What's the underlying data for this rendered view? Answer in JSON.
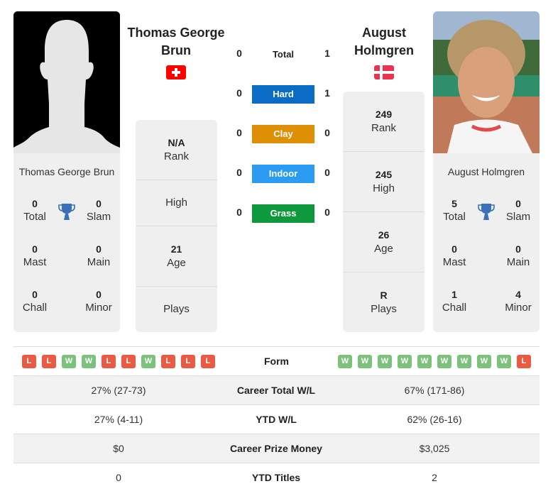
{
  "player_left": {
    "name": "Thomas George Brun",
    "name_line1": "Thomas George",
    "name_line2": "Brun",
    "country_flag": "switzerland-flag",
    "photo": "silhouette-placeholder",
    "titles": {
      "total": {
        "value": "0",
        "label": "Total"
      },
      "slam": {
        "value": "0",
        "label": "Slam"
      },
      "mast": {
        "value": "0",
        "label": "Mast"
      },
      "main": {
        "value": "0",
        "label": "Main"
      },
      "chall": {
        "value": "0",
        "label": "Chall"
      },
      "minor": {
        "value": "0",
        "label": "Minor"
      }
    },
    "ranking": [
      {
        "value": "N/A",
        "label": "Rank"
      },
      {
        "value": "",
        "label": "High"
      },
      {
        "value": "21",
        "label": "Age"
      },
      {
        "value": "",
        "label": "Plays"
      }
    ],
    "form": [
      "L",
      "L",
      "W",
      "W",
      "L",
      "L",
      "W",
      "L",
      "L",
      "L"
    ]
  },
  "player_right": {
    "name": "August Holmgren",
    "name_line1": "August",
    "name_line2": "Holmgren",
    "country_flag": "denmark-flag",
    "photo": "player-photo",
    "titles": {
      "total": {
        "value": "5",
        "label": "Total"
      },
      "slam": {
        "value": "0",
        "label": "Slam"
      },
      "mast": {
        "value": "0",
        "label": "Mast"
      },
      "main": {
        "value": "0",
        "label": "Main"
      },
      "chall": {
        "value": "1",
        "label": "Chall"
      },
      "minor": {
        "value": "4",
        "label": "Minor"
      }
    },
    "ranking": [
      {
        "value": "249",
        "label": "Rank"
      },
      {
        "value": "245",
        "label": "High"
      },
      {
        "value": "26",
        "label": "Age"
      },
      {
        "value": "R",
        "label": "Plays"
      }
    ],
    "form": [
      "W",
      "W",
      "W",
      "W",
      "W",
      "W",
      "W",
      "W",
      "W",
      "L"
    ]
  },
  "h2h": {
    "total": {
      "label": "Total",
      "left": "0",
      "right": "1"
    },
    "surfaces": [
      {
        "label": "Hard",
        "left": "0",
        "right": "1",
        "color": "#0a6cc4"
      },
      {
        "label": "Clay",
        "left": "0",
        "right": "0",
        "color": "#de8f06"
      },
      {
        "label": "Indoor",
        "left": "0",
        "right": "0",
        "color": "#2b9bf4"
      },
      {
        "label": "Grass",
        "left": "0",
        "right": "0",
        "color": "#0e9a3c"
      }
    ]
  },
  "form_label": "Form",
  "stats": [
    {
      "label": "Career Total W/L",
      "left": "27% (27-73)",
      "right": "67% (171-86)"
    },
    {
      "label": "YTD W/L",
      "left": "27% (4-11)",
      "right": "62% (26-16)"
    },
    {
      "label": "Career Prize Money",
      "left": "$0",
      "right": "$3,025"
    },
    {
      "label": "YTD Titles",
      "left": "0",
      "right": "2"
    }
  ],
  "colors": {
    "win": "#7cc17c",
    "loss": "#eb5a43",
    "trophy": "#3a6fba",
    "card_bg": "#efefef"
  }
}
